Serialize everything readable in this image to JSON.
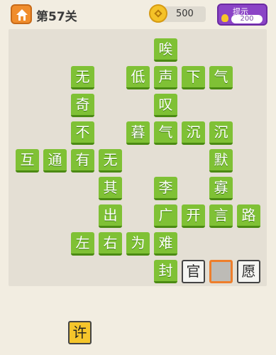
{
  "header": {
    "level_title": "第57关",
    "coins": "500",
    "hint_label": "提示",
    "hint_cost": "200"
  },
  "board": {
    "tiles": [
      "唉",
      "无",
      "低",
      "声",
      "下",
      "气",
      "奇",
      "叹",
      "不",
      "暮",
      "气",
      "沉",
      "沉",
      "互",
      "通",
      "有",
      "无",
      "默",
      "其",
      "李",
      "寡",
      "出",
      "广",
      "开",
      "言",
      "路",
      "左",
      "右",
      "为",
      "难",
      "封",
      "官",
      "",
      "愿"
    ]
  },
  "options": [
    "许"
  ],
  "colors": {
    "tile_green": "#7fc135",
    "accent_orange": "#f08d2c",
    "hint_purple": "#8b44c6",
    "option_yellow": "#f5c52b"
  }
}
